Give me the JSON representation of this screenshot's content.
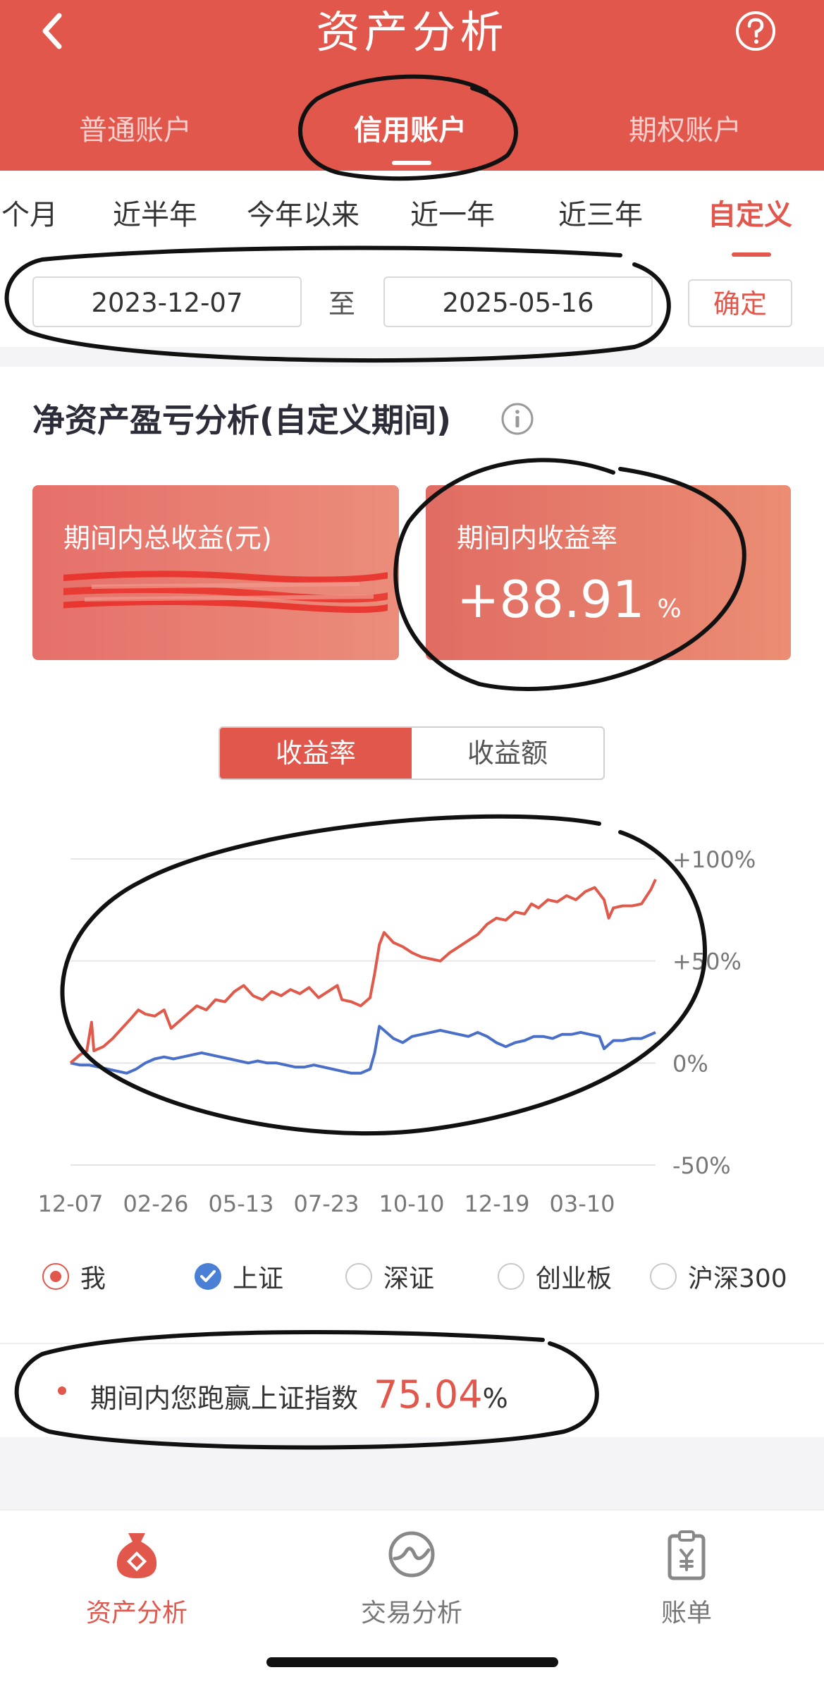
{
  "header": {
    "title": "资产分析",
    "back_icon": "chevron-left-icon",
    "help_icon": "question-circle-icon"
  },
  "account_tabs": [
    {
      "label": "普通账户",
      "active": false
    },
    {
      "label": "信用账户",
      "active": true
    },
    {
      "label": "期权账户",
      "active": false
    }
  ],
  "period_tabs": [
    {
      "label": "近三个月",
      "active": false
    },
    {
      "label": "近半年",
      "active": false
    },
    {
      "label": "今年以来",
      "active": false
    },
    {
      "label": "近一年",
      "active": false
    },
    {
      "label": "近三年",
      "active": false
    },
    {
      "label": "自定义",
      "active": true
    }
  ],
  "date_range": {
    "start": "2023-12-07",
    "separator": "至",
    "end": "2025-05-16",
    "confirm_label": "确定"
  },
  "section": {
    "title": "净资产盈亏分析(自定义期间)",
    "info_icon": "info-circle-icon"
  },
  "cards": {
    "total_profit": {
      "label": "期间内总收益(元)"
    },
    "return_rate": {
      "label": "期间内收益率",
      "value": "+88.91",
      "unit": "%"
    }
  },
  "chart_toggle": [
    {
      "label": "收益率",
      "active": true
    },
    {
      "label": "收益额",
      "active": false
    }
  ],
  "chart_data": {
    "type": "line",
    "x_ticks": [
      "12-07",
      "02-26",
      "05-13",
      "07-23",
      "10-10",
      "12-19",
      "03-10"
    ],
    "y_ticks": [
      100,
      50,
      0,
      -50
    ],
    "y_tick_labels": [
      "+100%",
      "+50%",
      "0%",
      "-50%"
    ],
    "ylim": [
      -50,
      100
    ],
    "grid": true,
    "series": [
      {
        "name": "我",
        "color": "#e05a4b",
        "points": [
          [
            0,
            0
          ],
          [
            0.02,
            4
          ],
          [
            0.035,
            6
          ],
          [
            0.045,
            20
          ],
          [
            0.05,
            6
          ],
          [
            0.07,
            8
          ],
          [
            0.09,
            12
          ],
          [
            0.11,
            17
          ],
          [
            0.13,
            22
          ],
          [
            0.145,
            26
          ],
          [
            0.16,
            24
          ],
          [
            0.18,
            23
          ],
          [
            0.2,
            26
          ],
          [
            0.215,
            17
          ],
          [
            0.23,
            20
          ],
          [
            0.25,
            24
          ],
          [
            0.27,
            28
          ],
          [
            0.29,
            26
          ],
          [
            0.31,
            31
          ],
          [
            0.33,
            30
          ],
          [
            0.35,
            35
          ],
          [
            0.37,
            38
          ],
          [
            0.39,
            33
          ],
          [
            0.41,
            31
          ],
          [
            0.43,
            35
          ],
          [
            0.45,
            33
          ],
          [
            0.47,
            36
          ],
          [
            0.49,
            34
          ],
          [
            0.51,
            37
          ],
          [
            0.53,
            32
          ],
          [
            0.55,
            35
          ],
          [
            0.57,
            38
          ],
          [
            0.58,
            31
          ],
          [
            0.6,
            30
          ],
          [
            0.62,
            28
          ],
          [
            0.64,
            32
          ],
          [
            0.65,
            44
          ],
          [
            0.66,
            58
          ],
          [
            0.67,
            64
          ],
          [
            0.69,
            59
          ],
          [
            0.71,
            57
          ],
          [
            0.73,
            54
          ],
          [
            0.75,
            52
          ],
          [
            0.77,
            51
          ],
          [
            0.79,
            50
          ],
          [
            0.81,
            54
          ],
          [
            0.83,
            57
          ],
          [
            0.85,
            60
          ],
          [
            0.87,
            63
          ],
          [
            0.89,
            68
          ],
          [
            0.91,
            71
          ],
          [
            0.93,
            70
          ],
          [
            0.95,
            74
          ],
          [
            0.97,
            73
          ],
          [
            0.985,
            78
          ],
          [
            1.0,
            76
          ],
          [
            1.02,
            80
          ],
          [
            1.04,
            79
          ],
          [
            1.06,
            82
          ],
          [
            1.08,
            80
          ],
          [
            1.1,
            84
          ],
          [
            1.12,
            86
          ],
          [
            1.14,
            80
          ],
          [
            1.15,
            71
          ],
          [
            1.16,
            76
          ],
          [
            1.18,
            77
          ],
          [
            1.2,
            77
          ],
          [
            1.22,
            78
          ],
          [
            1.24,
            85
          ],
          [
            1.25,
            90
          ]
        ]
      },
      {
        "name": "上证",
        "color": "#4a6fc9",
        "points": [
          [
            0,
            0
          ],
          [
            0.02,
            -1
          ],
          [
            0.04,
            -1
          ],
          [
            0.06,
            -2
          ],
          [
            0.08,
            -3
          ],
          [
            0.1,
            -4
          ],
          [
            0.12,
            -5
          ],
          [
            0.14,
            -3
          ],
          [
            0.16,
            0
          ],
          [
            0.18,
            2
          ],
          [
            0.2,
            3
          ],
          [
            0.22,
            2
          ],
          [
            0.24,
            3
          ],
          [
            0.26,
            4
          ],
          [
            0.28,
            5
          ],
          [
            0.3,
            4
          ],
          [
            0.32,
            3
          ],
          [
            0.34,
            2
          ],
          [
            0.36,
            1
          ],
          [
            0.38,
            0
          ],
          [
            0.4,
            1
          ],
          [
            0.42,
            0
          ],
          [
            0.44,
            0
          ],
          [
            0.46,
            -1
          ],
          [
            0.48,
            -2
          ],
          [
            0.5,
            -2
          ],
          [
            0.52,
            -1
          ],
          [
            0.54,
            -2
          ],
          [
            0.56,
            -3
          ],
          [
            0.58,
            -4
          ],
          [
            0.6,
            -5
          ],
          [
            0.62,
            -5
          ],
          [
            0.64,
            -3
          ],
          [
            0.65,
            5
          ],
          [
            0.66,
            18
          ],
          [
            0.67,
            16
          ],
          [
            0.69,
            12
          ],
          [
            0.71,
            10
          ],
          [
            0.73,
            13
          ],
          [
            0.75,
            14
          ],
          [
            0.77,
            15
          ],
          [
            0.79,
            16
          ],
          [
            0.81,
            15
          ],
          [
            0.83,
            14
          ],
          [
            0.85,
            13
          ],
          [
            0.87,
            15
          ],
          [
            0.89,
            13
          ],
          [
            0.91,
            10
          ],
          [
            0.93,
            8
          ],
          [
            0.95,
            10
          ],
          [
            0.97,
            11
          ],
          [
            0.99,
            13
          ],
          [
            1.01,
            13
          ],
          [
            1.03,
            12
          ],
          [
            1.05,
            14
          ],
          [
            1.07,
            14
          ],
          [
            1.09,
            15
          ],
          [
            1.11,
            14
          ],
          [
            1.13,
            13
          ],
          [
            1.14,
            7
          ],
          [
            1.15,
            9
          ],
          [
            1.16,
            11
          ],
          [
            1.18,
            11
          ],
          [
            1.2,
            12
          ],
          [
            1.22,
            12
          ],
          [
            1.24,
            14
          ],
          [
            1.25,
            15
          ]
        ]
      }
    ]
  },
  "legend": [
    {
      "label": "我",
      "state": "radio-on"
    },
    {
      "label": "上证",
      "state": "checked"
    },
    {
      "label": "深证",
      "state": "off"
    },
    {
      "label": "创业板",
      "state": "off"
    },
    {
      "label": "沪深300",
      "state": "off"
    }
  ],
  "beat": {
    "text": "期间内您跑赢上证指数",
    "value": "75.04",
    "unit": "%"
  },
  "tabbar": [
    {
      "label": "资产分析",
      "icon": "money-bag-icon",
      "active": true
    },
    {
      "label": "交易分析",
      "icon": "trend-circle-icon",
      "active": false
    },
    {
      "label": "账单",
      "icon": "bill-clipboard-icon",
      "active": false
    }
  ],
  "colors": {
    "brand_red": "#e2574c",
    "series_blue": "#4a6fc9"
  }
}
